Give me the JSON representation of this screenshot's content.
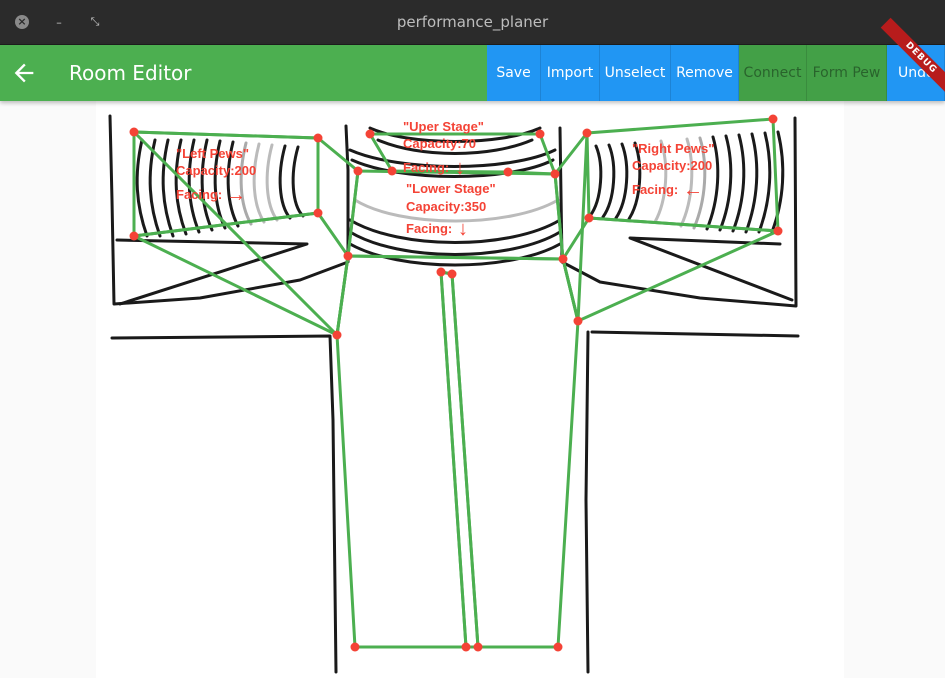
{
  "window": {
    "title": "performance_planer",
    "close_glyph": "×",
    "minimize_glyph": "–",
    "maximize_glyph": "⤡"
  },
  "appbar": {
    "title": "Room Editor",
    "back_icon": "arrow-back-icon",
    "actions": [
      {
        "label": "Save",
        "enabled": true
      },
      {
        "label": "Import",
        "enabled": true
      },
      {
        "label": "Unselect",
        "enabled": true
      },
      {
        "label": "Remove",
        "enabled": true
      },
      {
        "label": "Connect",
        "enabled": false
      },
      {
        "label": "Form Pew",
        "enabled": false
      },
      {
        "label": "Undo",
        "enabled": true
      }
    ],
    "debug_banner": "DEBUG"
  },
  "colors": {
    "appbar": "#4caf50",
    "action_blue": "#2196f3",
    "polygon_stroke": "#4caf50",
    "vertex": "#f44336",
    "label": "#f44336"
  },
  "regions": [
    {
      "name": "\"Left Pews\"",
      "capacity": "Capacity:200",
      "facing": "Facing:",
      "facing_arrow": "→"
    },
    {
      "name": "\"Uper Stage\"",
      "capacity": "Capacity:70",
      "facing": "Facing:",
      "facing_arrow": "↓"
    },
    {
      "name": "\"Lower Stage\"",
      "capacity": "Capacity:350",
      "facing": "Facing:",
      "facing_arrow": "↓"
    },
    {
      "name": "\"Right Pews\"",
      "capacity": "Capacity:200",
      "facing": "Facing:",
      "facing_arrow": "←"
    }
  ]
}
